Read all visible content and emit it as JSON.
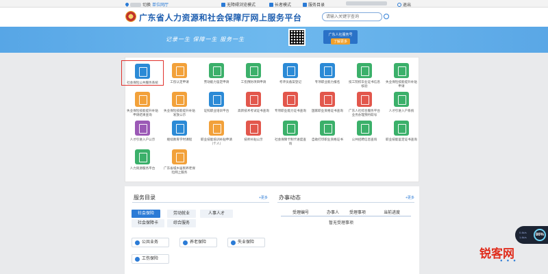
{
  "topbar": {
    "switch": "切换",
    "unit_hall": "单位网厅",
    "accessible": "无障碍浏览模式",
    "elderly": "长者模式",
    "service_dir": "服务目录",
    "logout": "退出"
  },
  "header": {
    "title": "广东省人力资源和社会保障厅网上服务平台",
    "search_placeholder": "请输入关键字查询"
  },
  "banner": {
    "slogan": "记录一生  保障一生  服务一生",
    "card_title": "广东人社服务号",
    "card_button": "了解更多"
  },
  "services": [
    {
      "label": "社会保险公共服务系统",
      "color": "#2b8ad6",
      "selected": true
    },
    {
      "label": "工伤认定申请",
      "color": "#f2a13a"
    },
    {
      "label": "劳动能力鉴定申请",
      "color": "#3bb06a"
    },
    {
      "label": "工伤预防项目申请",
      "color": "#3bb06a"
    },
    {
      "label": "考评员备案登记",
      "color": "#2b8ad6"
    },
    {
      "label": "专项职业能力报名",
      "color": "#2b8ad6"
    },
    {
      "label": "技工院校毕业证书信息核验",
      "color": "#3bb06a"
    },
    {
      "label": "失业保险技能提升补贴申请",
      "color": "#3bb06a"
    },
    {
      "label": "失业保险技能提升补贴申请结果查询",
      "color": "#f2a13a"
    },
    {
      "label": "失业保险技能提升补贴发放公示",
      "color": "#f2a13a"
    },
    {
      "label": "证照职业培训平台",
      "color": "#2b8ad6"
    },
    {
      "label": "高新技术考试证书查询",
      "color": "#e2574c"
    },
    {
      "label": "专项职业能力证书查询",
      "color": "#e2574c"
    },
    {
      "label": "国家职业资格证书查询",
      "color": "#e2574c"
    },
    {
      "label": "广东人社综合服务平台业务办理预约取号",
      "color": "#e2574c"
    },
    {
      "label": "人才引进入户系统",
      "color": "#3bb06a"
    },
    {
      "label": "人才引进入户公示",
      "color": "#9b59b6"
    },
    {
      "label": "继续教育学时课程",
      "color": "#2b8ad6"
    },
    {
      "label": "职业技能培训补贴申请（个人）",
      "color": "#f2a13a"
    },
    {
      "label": "技师补贴公示",
      "color": "#e2574c"
    },
    {
      "label": "社会保障卡制卡进度查询",
      "color": "#3bb06a"
    },
    {
      "label": "自助打印职业资格证书",
      "color": "#3bb06a"
    },
    {
      "label": "公共招聘信息查询",
      "color": "#3bb06a"
    },
    {
      "label": "职业技能鉴定证书查询",
      "color": "#3bb06a"
    },
    {
      "label": "人力资源服务平台",
      "color": "#3bb06a"
    },
    {
      "label": "广东省城乡居民养老保险网上服务",
      "color": "#f2a13a"
    }
  ],
  "service_directory": {
    "title": "服务目录",
    "more": "+更多",
    "categories": [
      "社会保险",
      "劳动就业",
      "人事人才",
      "社会保障卡",
      "综合服务"
    ],
    "items": [
      "公共业务",
      "养老保险",
      "失业保险",
      "工伤保险"
    ]
  },
  "affairs": {
    "title": "办事动态",
    "more": "+更多",
    "headers": [
      "受理编号",
      "办事人",
      "受理事项",
      "当前进度"
    ],
    "empty": "暂无受理事项"
  },
  "widget": {
    "percent": "86%",
    "stat1": "0.4k/s",
    "stat2": "1.4k/s"
  },
  "watermark": "锐客网"
}
